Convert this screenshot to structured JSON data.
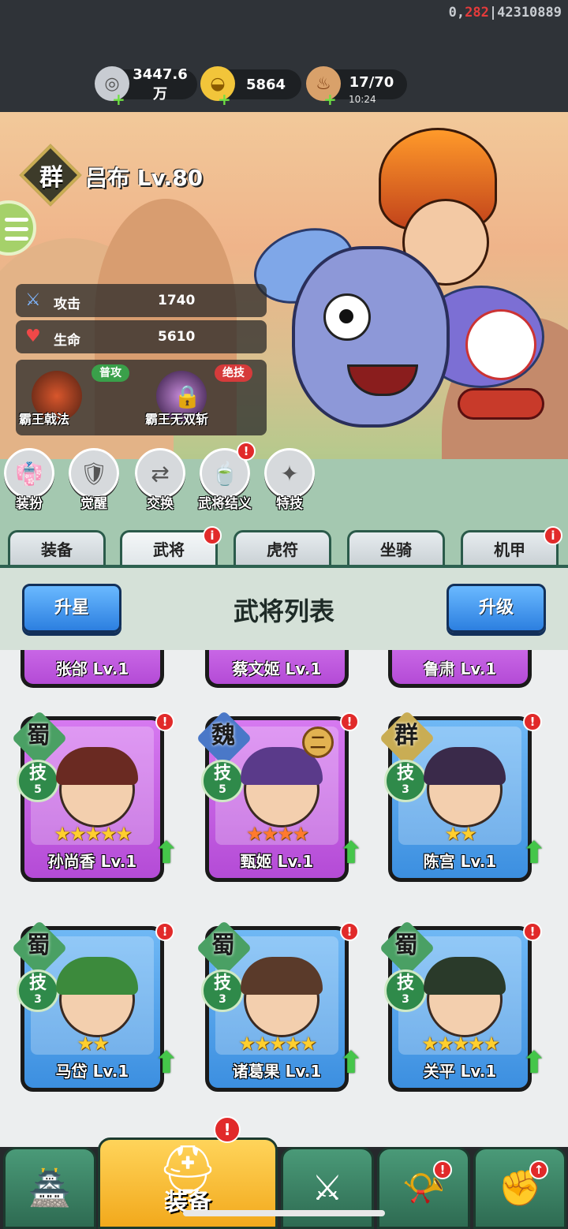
{
  "debug": {
    "prefix": "0,",
    "red": "282",
    "rest": "|42310889"
  },
  "resources": [
    {
      "icon": "silver-coin-icon",
      "value": "3447.6万"
    },
    {
      "icon": "gold-ingot-icon",
      "value": "5864"
    },
    {
      "icon": "meat-stamina-icon",
      "value": "17/70",
      "timer": "10:24"
    }
  ],
  "hero": {
    "faction": "群",
    "name": "吕布 Lv.80",
    "stats": [
      {
        "icon": "sword-icon",
        "label": "攻击",
        "value": "1740"
      },
      {
        "icon": "heart-icon",
        "label": "生命",
        "value": "5610"
      }
    ],
    "skills": [
      {
        "tag": "普攻",
        "name": "霸王戟法",
        "locked": false
      },
      {
        "tag": "绝技",
        "name": "霸王无双斩",
        "locked": true
      }
    ]
  },
  "actions": [
    {
      "label": "装扮",
      "icon": "outfit-icon",
      "badge": ""
    },
    {
      "label": "觉醒",
      "icon": "awaken-icon",
      "badge": ""
    },
    {
      "label": "交换",
      "icon": "exchange-icon",
      "badge": ""
    },
    {
      "label": "武将结义",
      "icon": "brotherhood-icon",
      "badge": "!"
    },
    {
      "label": "特技",
      "icon": "special-skill-icon",
      "badge": ""
    }
  ],
  "tabs": [
    {
      "label": "装备",
      "badge": ""
    },
    {
      "label": "武将",
      "badge": "i"
    },
    {
      "label": "虎符",
      "badge": ""
    },
    {
      "label": "坐骑",
      "badge": ""
    },
    {
      "label": "机甲",
      "badge": "i"
    }
  ],
  "panel": {
    "title": "武将列表",
    "left_button": "升星",
    "right_button": "升级"
  },
  "partial_cards": [
    "张郃 Lv.1",
    "蔡文姬 Lv.1",
    "鲁肃 Lv.1"
  ],
  "cards": [
    {
      "kingdom": "蜀",
      "skill": "技",
      "skill_level": "5",
      "stars": "★★★★★",
      "name": "孙尚香 Lv.1",
      "rarity": "purple",
      "rank": ""
    },
    {
      "kingdom": "魏",
      "skill": "技",
      "skill_level": "5",
      "stars": "★★★★",
      "name": "甄姬 Lv.1",
      "rarity": "purple",
      "rank": "二"
    },
    {
      "kingdom": "群",
      "skill": "技",
      "skill_level": "3",
      "stars": "★★",
      "name": "陈宫 Lv.1",
      "rarity": "blue",
      "rank": ""
    },
    {
      "kingdom": "蜀",
      "skill": "技",
      "skill_level": "3",
      "stars": "★★",
      "name": "马岱 Lv.1",
      "rarity": "blue",
      "rank": ""
    },
    {
      "kingdom": "蜀",
      "skill": "技",
      "skill_level": "3",
      "stars": "★★★★★",
      "name": "诸葛果 Lv.1",
      "rarity": "blue",
      "rank": ""
    },
    {
      "kingdom": "蜀",
      "skill": "技",
      "skill_level": "3",
      "stars": "★★★★★",
      "name": "关平 Lv.1",
      "rarity": "blue",
      "rank": ""
    }
  ],
  "bottom_nav": [
    {
      "icon": "city-gate-icon",
      "label": ""
    },
    {
      "icon": "helmet-icon",
      "label": "装备"
    },
    {
      "icon": "crossed-swords-icon",
      "label": ""
    },
    {
      "icon": "horn-icon",
      "label": ""
    },
    {
      "icon": "fist-upgrade-icon",
      "label": ""
    }
  ],
  "colors": {
    "purple_card": "#c35fe3",
    "blue_card": "#4d9ce8",
    "accent_green": "#45c64a",
    "alert_red": "#e12a2a"
  }
}
